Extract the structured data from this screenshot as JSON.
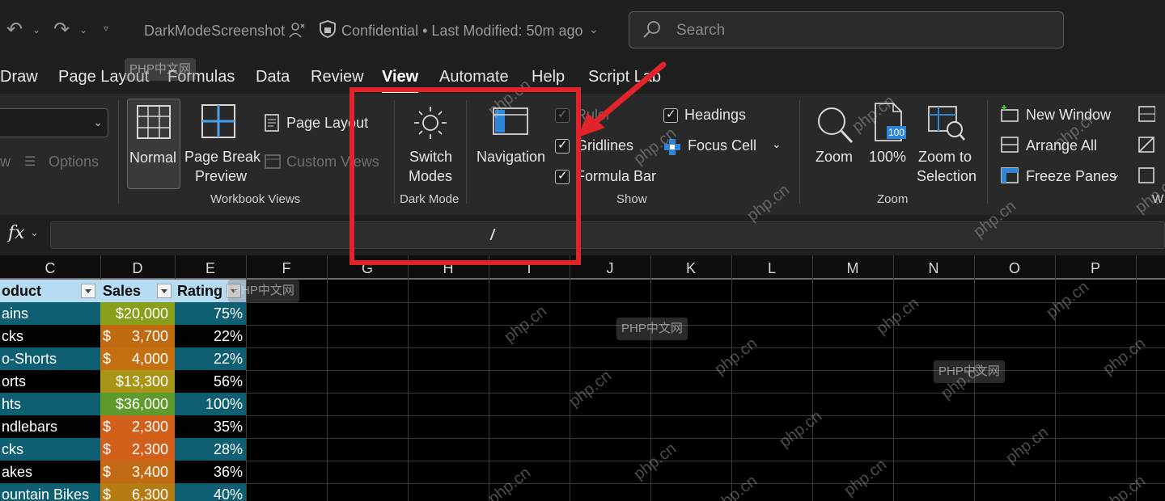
{
  "title_bar": {
    "undo_icon": "undo-icon",
    "redo_icon": "redo-icon",
    "qat_icon": "customize-quick-access-icon",
    "document_name": "DarkModeScreenshot",
    "sensitivity_label": "Confidential",
    "separator": "•",
    "last_modified": "Last Modified: 50m ago",
    "search_placeholder": "Search"
  },
  "menu_tabs": [
    {
      "label": "Draw"
    },
    {
      "label": "Page Layout"
    },
    {
      "label": "Formulas"
    },
    {
      "label": "Data"
    },
    {
      "label": "Review"
    },
    {
      "label": "View",
      "active": true
    },
    {
      "label": "Automate"
    },
    {
      "label": "Help"
    },
    {
      "label": "Script Lab"
    }
  ],
  "ribbon": {
    "sheet_view": {
      "options_label": "Options",
      "w_label": "w"
    },
    "workbook_views": {
      "group_label": "Workbook Views",
      "normal": "Normal",
      "page_break_line1": "Page Break",
      "page_break_line2": "Preview",
      "page_layout": "Page Layout",
      "custom_views": "Custom Views"
    },
    "dark_mode": {
      "group_label": "Dark Mode",
      "switch_line1": "Switch",
      "switch_line2": "Modes"
    },
    "navigation": {
      "label": "Navigation"
    },
    "show": {
      "group_label": "Show",
      "ruler": "Ruler",
      "gridlines": "Gridlines",
      "formula_bar": "Formula Bar",
      "headings": "Headings",
      "focus_cell": "Focus Cell"
    },
    "zoom": {
      "group_label": "Zoom",
      "zoom": "Zoom",
      "hundred": "100%",
      "hundred_badge": "100",
      "selection_line1": "Zoom to",
      "selection_line2": "Selection"
    },
    "window": {
      "new_window": "New Window",
      "arrange_all": "Arrange All",
      "freeze_panes": "Freeze Panes",
      "group_label_partial": "W"
    }
  },
  "formula_bar": {
    "fx_label": "fx",
    "value": ""
  },
  "columns": [
    "C",
    "D",
    "E",
    "F",
    "G",
    "H",
    "I",
    "J",
    "K",
    "L",
    "M",
    "N",
    "O",
    "P"
  ],
  "table": {
    "headers": {
      "product": "oduct",
      "sales": "Sales",
      "rating": "Rating"
    },
    "rows": [
      {
        "product": "ains",
        "currency": "",
        "amount": "$20,000",
        "rating": "75%",
        "prod_color": "#0f5f73",
        "sales_color": "#86a01a",
        "rate_color": "#0f5f73"
      },
      {
        "product": "cks",
        "currency": "$",
        "amount": "3,700",
        "rating": "22%",
        "prod_color": "#000000",
        "sales_color": "#c06a12",
        "rate_color": "#000000"
      },
      {
        "product": "o-Shorts",
        "currency": "$",
        "amount": "4,000",
        "rating": "22%",
        "prod_color": "#0f5f73",
        "sales_color": "#c57010",
        "rate_color": "#0f5f73"
      },
      {
        "product": "orts",
        "currency": "",
        "amount": "$13,300",
        "rating": "56%",
        "prod_color": "#000000",
        "sales_color": "#a99417",
        "rate_color": "#000000"
      },
      {
        "product": "hts",
        "currency": "",
        "amount": "$36,000",
        "rating": "100%",
        "prod_color": "#0f5f73",
        "sales_color": "#5e9a2c",
        "rate_color": "#0f5f73"
      },
      {
        "product": "ndlebars",
        "currency": "$",
        "amount": "2,300",
        "rating": "35%",
        "prod_color": "#000000",
        "sales_color": "#d2601a",
        "rate_color": "#000000"
      },
      {
        "product": "cks",
        "currency": "$",
        "amount": "2,300",
        "rating": "28%",
        "prod_color": "#0f5f73",
        "sales_color": "#d2601a",
        "rate_color": "#0f5f73"
      },
      {
        "product": "akes",
        "currency": "$",
        "amount": "3,400",
        "rating": "36%",
        "prod_color": "#000000",
        "sales_color": "#c36b14",
        "rate_color": "#000000"
      },
      {
        "product": "ountain Bikes",
        "currency": "$",
        "amount": "6,300",
        "rating": "40%",
        "prod_color": "#0f5f73",
        "sales_color": "#b57c14",
        "rate_color": "#0f5f73"
      }
    ]
  },
  "annotation": {
    "highlight_color": "#e1242a",
    "arrow_color": "#e1242a"
  },
  "watermarks": {
    "site": "php.cn",
    "box": "PHP中文网"
  }
}
